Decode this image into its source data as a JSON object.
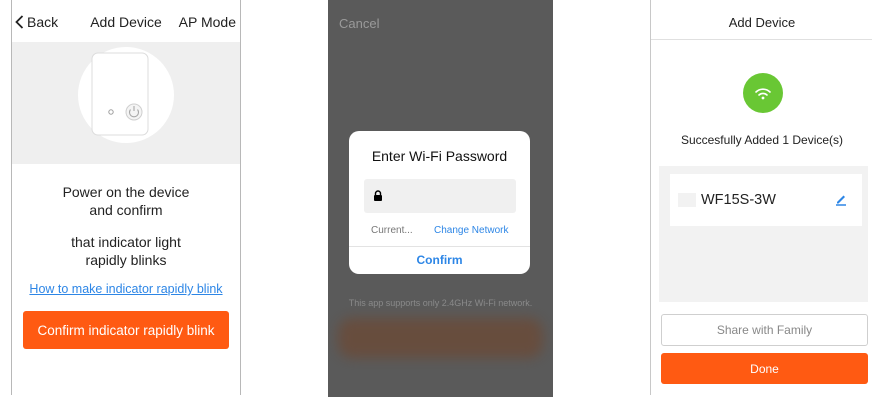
{
  "screen1": {
    "back_label": "Back",
    "title": "Add Device",
    "mode": "AP Mode",
    "instruction_line1": "Power on the device",
    "instruction_line2": "and confirm",
    "instruction_line3": "that indicator light",
    "instruction_line4": "rapidly blinks",
    "help_link": "How to make indicator rapidly blink",
    "confirm_button": "Confirm indicator rapidly blink"
  },
  "screen2": {
    "cancel": "Cancel",
    "dialog_title": "Enter Wi-Fi Password",
    "current_network": "Current...",
    "change_network": "Change Network",
    "confirm": "Confirm",
    "note": "This app supports only 2.4GHz Wi-Fi network."
  },
  "screen3": {
    "title": "Add Device",
    "success_message": "Succesfully Added 1 Device(s)",
    "device_name": "WF15S-3W",
    "share_button": "Share with Family",
    "done_button": "Done"
  },
  "colors": {
    "accent_orange": "#ff5a12",
    "link_blue": "#2d86e6",
    "success_green": "#69c734"
  }
}
